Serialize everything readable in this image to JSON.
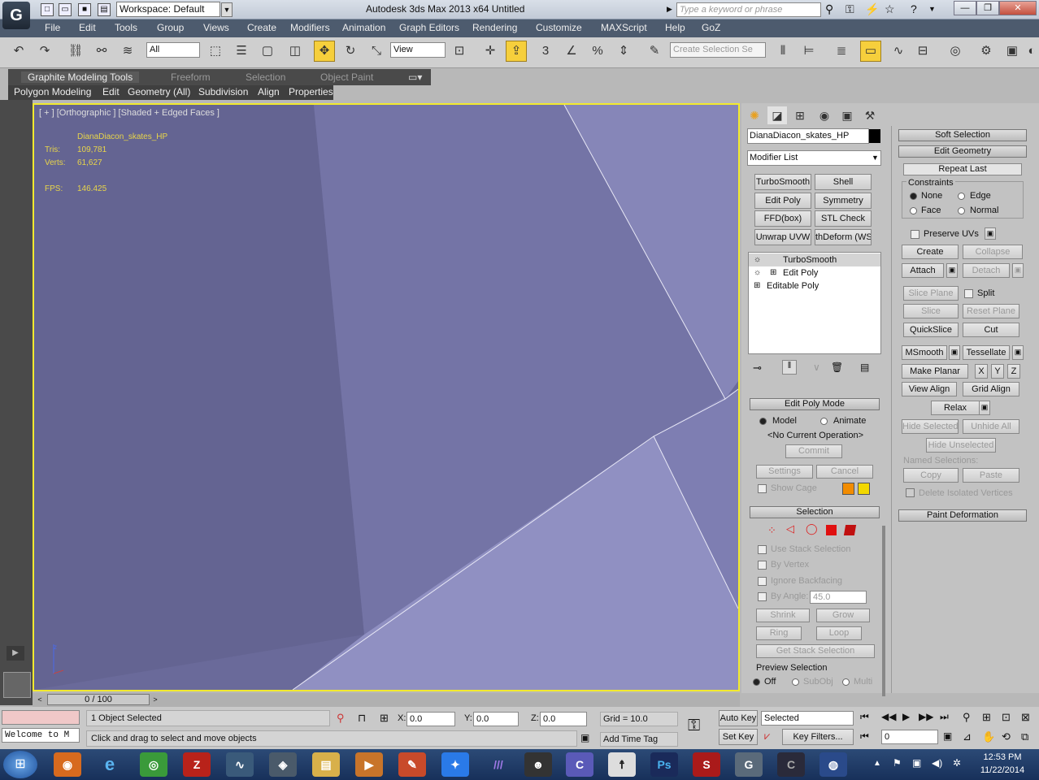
{
  "window": {
    "title": "Autodesk 3ds Max  2013 x64     Untitled",
    "workspace": "Workspace: Default",
    "search_placeholder": "Type a keyword or phrase",
    "minimize": "—",
    "maximize": "❐",
    "close": "✕"
  },
  "menu": [
    "File",
    "Edit",
    "Tools",
    "Group",
    "Views",
    "Create",
    "Modifiers",
    "Animation",
    "Graph Editors",
    "Rendering",
    "Customize",
    "MAXScript",
    "Help",
    "GoZ"
  ],
  "toolbar": {
    "selection_filter": "All",
    "ref_coord": "View",
    "named_selection_placeholder": "Create Selection Se"
  },
  "ribbon": {
    "tabs": [
      "Graphite Modeling Tools",
      "Freeform",
      "Selection",
      "Object Paint"
    ],
    "subtabs": [
      "Polygon Modeling",
      "Edit",
      "Geometry (All)",
      "Subdivision",
      "Align",
      "Properties"
    ]
  },
  "viewport": {
    "label": "[ + ] [Orthographic ] [Shaded + Edged Faces ]",
    "object_name": "DianaDiacon_skates_HP",
    "tris_label": "Tris:",
    "tris_value": "109,781",
    "verts_label": "Verts:",
    "verts_value": "61,627",
    "fps_label": "FPS:",
    "fps_value": "146.425",
    "colors": {
      "border": "#f2ea2e",
      "stats": "#e8d54a"
    }
  },
  "timeline": {
    "frame": "0 / 100"
  },
  "command_panel": {
    "object_name": "DianaDiacon_skates_HP",
    "modifier_list": "Modifier List",
    "modifier_buttons": [
      "TurboSmooth",
      "Shell",
      "Edit Poly",
      "Symmetry",
      "FFD(box)",
      "STL Check",
      "Unwrap UVW",
      "thDeform (WSI"
    ],
    "stack": [
      "TurboSmooth",
      "Edit Poly",
      "Editable Poly"
    ],
    "edit_poly_mode": {
      "title": "Edit Poly Mode",
      "model": "Model",
      "animate": "Animate",
      "operation": "<No Current Operation>",
      "commit": "Commit",
      "settings": "Settings",
      "cancel": "Cancel",
      "show_cage": "Show Cage"
    },
    "selection": {
      "title": "Selection",
      "use_stack": "Use Stack Selection",
      "by_vertex": "By Vertex",
      "ignore_backfacing": "Ignore Backfacing",
      "by_angle": "By Angle:",
      "angle_value": "45.0",
      "shrink": "Shrink",
      "grow": "Grow",
      "ring": "Ring",
      "loop": "Loop",
      "get_stack": "Get Stack Selection",
      "preview": "Preview Selection",
      "off": "Off",
      "subobj": "SubObj",
      "multi": "Multi"
    },
    "soft_selection": "Soft Selection",
    "edit_geometry": {
      "title": "Edit Geometry",
      "repeat_last": "Repeat Last",
      "constraints": "Constraints",
      "none": "None",
      "edge": "Edge",
      "face": "Face",
      "normal": "Normal",
      "preserve_uvs": "Preserve UVs",
      "create": "Create",
      "collapse": "Collapse",
      "attach": "Attach",
      "detach": "Detach",
      "slice_plane": "Slice Plane",
      "split": "Split",
      "slice": "Slice",
      "reset_plane": "Reset Plane",
      "quickslice": "QuickSlice",
      "cut": "Cut",
      "msmooth": "MSmooth",
      "tessellate": "Tessellate",
      "make_planar": "Make Planar",
      "x": "X",
      "y": "Y",
      "z": "Z",
      "view_align": "View Align",
      "grid_align": "Grid Align",
      "relax": "Relax",
      "hide_selected": "Hide Selected",
      "unhide_all": "Unhide All",
      "hide_unselected": "Hide Unselected",
      "named_selections": "Named Selections:",
      "copy": "Copy",
      "paste": "Paste",
      "delete_isolated": "Delete Isolated Vertices"
    },
    "paint_deformation": "Paint Deformation"
  },
  "status": {
    "selected": "1 Object Selected",
    "prompt": "Click and drag to select and move objects",
    "maxscript": "Welcome to M",
    "x_label": "X:",
    "x_value": "0.0",
    "y_label": "Y:",
    "y_value": "0.0",
    "z_label": "Z:",
    "z_value": "0.0",
    "grid": "Grid = 10.0",
    "add_time_tag": "Add Time Tag",
    "auto_key": "Auto Key",
    "set_key": "Set Key",
    "key_mode": "Selected",
    "key_filters": "Key Filters...",
    "frame_value": "0"
  },
  "taskbar": {
    "time": "12:53 PM",
    "date": "11/22/2014"
  }
}
